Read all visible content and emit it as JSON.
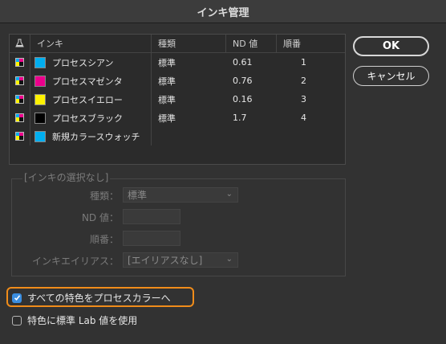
{
  "window": {
    "title": "インキ管理"
  },
  "table": {
    "headers": {
      "icon": "",
      "ink": "インキ",
      "type": "種類",
      "nd": "ND 値",
      "order": "順番"
    },
    "rows": [
      {
        "name": "プロセスシアン",
        "type": "標準",
        "nd": "0.61",
        "order": "1",
        "color": "#00aeef"
      },
      {
        "name": "プロセスマゼンタ",
        "type": "標準",
        "nd": "0.76",
        "order": "2",
        "color": "#ec008c"
      },
      {
        "name": "プロセスイエロー",
        "type": "標準",
        "nd": "0.16",
        "order": "3",
        "color": "#fff200"
      },
      {
        "name": "プロセスブラック",
        "type": "標準",
        "nd": "1.7",
        "order": "4",
        "color": "#000000"
      },
      {
        "name": "新規カラースウォッチ",
        "type": "",
        "nd": "",
        "order": "",
        "color": "#00aeef"
      }
    ]
  },
  "buttons": {
    "ok": "OK",
    "cancel": "キャンセル"
  },
  "details": {
    "group_title": "[インキの選択なし]",
    "type_label": "種類：",
    "type_value": "標準",
    "nd_label": "ND 値：",
    "order_label": "順番：",
    "alias_label": "インキエイリアス：",
    "alias_value": "[エイリアスなし]"
  },
  "options": {
    "all_spots_to_process": {
      "label": "すべての特色をプロセスカラーへ",
      "checked": true
    },
    "use_standard_lab": {
      "label": "特色に標準 Lab 値を使用",
      "checked": false
    }
  },
  "icons": {
    "header_icon": "ink-bottle-icon",
    "row_icon": "process-color-icon",
    "dropdown": "chevron-down-icon",
    "check": "checkmark-icon"
  }
}
